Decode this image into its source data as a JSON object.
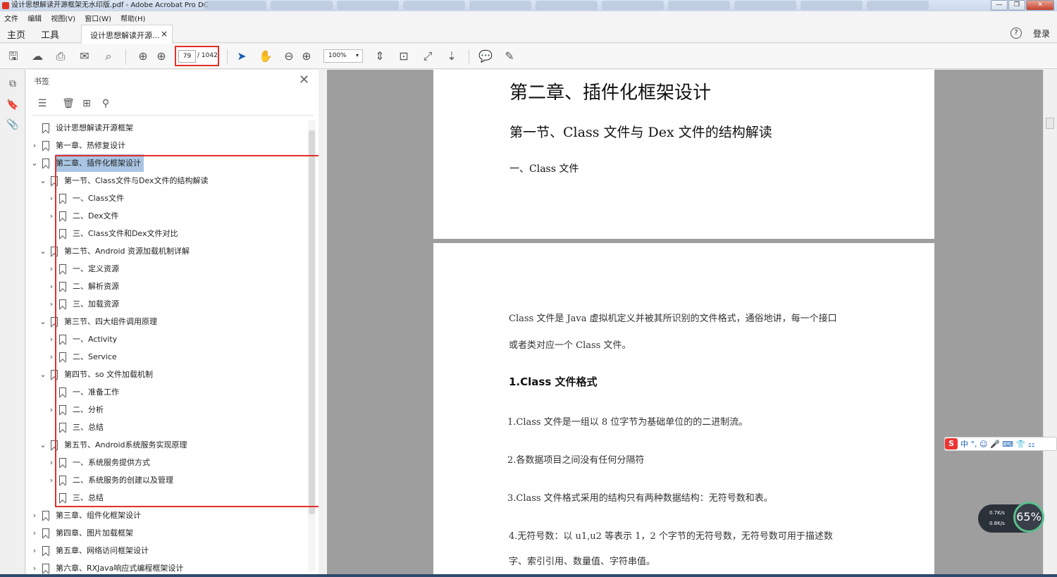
{
  "window": {
    "title": "设计思想解读开源框架无水印版.pdf - Adobe Acrobat Pro DC",
    "controls": [
      "—",
      "❐",
      "✕"
    ]
  },
  "menu": [
    "文件",
    "编辑",
    "视图(V)",
    "窗口(W)",
    "帮助(H)"
  ],
  "topnav": {
    "home": "主页",
    "tools": "工具",
    "doc_tab": "设计思想解读开源...",
    "close": "×",
    "help": "?",
    "login": "登录"
  },
  "toolbar": {
    "page_current": "79",
    "page_total": "/ 1042",
    "zoom": "100%"
  },
  "bookmarks": {
    "title": "书签",
    "items": [
      {
        "label": "设计思想解读开源框架",
        "level": 0,
        "chev": ""
      },
      {
        "label": "第一章、热修复设计",
        "level": 0,
        "chev": "›"
      },
      {
        "label": "第二章、插件化框架设计",
        "level": 0,
        "chev": "⌄"
      },
      {
        "label": "第一节、Class文件与Dex文件的结构解读",
        "level": 1,
        "chev": "⌄"
      },
      {
        "label": "一、Class文件",
        "level": 2,
        "chev": "›"
      },
      {
        "label": "二、Dex文件",
        "level": 2,
        "chev": "›"
      },
      {
        "label": "三、Class文件和Dex文件对比",
        "level": 2,
        "chev": ""
      },
      {
        "label": "第二节、Android 资源加载机制详解",
        "level": 1,
        "chev": "⌄"
      },
      {
        "label": "一、定义资源",
        "level": 2,
        "chev": "›"
      },
      {
        "label": "二、解析资源",
        "level": 2,
        "chev": "›"
      },
      {
        "label": "三、加载资源",
        "level": 2,
        "chev": "›"
      },
      {
        "label": "第三节、四大组件调用原理",
        "level": 1,
        "chev": "⌄"
      },
      {
        "label": "一、Activity",
        "level": 2,
        "chev": "›"
      },
      {
        "label": "二、Service",
        "level": 2,
        "chev": "›"
      },
      {
        "label": "第四节、so 文件加载机制",
        "level": 1,
        "chev": "⌄"
      },
      {
        "label": "一、准备工作",
        "level": 2,
        "chev": ""
      },
      {
        "label": "二、分析",
        "level": 2,
        "chev": "›"
      },
      {
        "label": "三、总结",
        "level": 2,
        "chev": ""
      },
      {
        "label": "第五节、Android系统服务实现原理",
        "level": 1,
        "chev": "⌄"
      },
      {
        "label": "一、系统服务提供方式",
        "level": 2,
        "chev": "›"
      },
      {
        "label": "二、系统服务的创建以及管理",
        "level": 2,
        "chev": "›"
      },
      {
        "label": "三、总结",
        "level": 2,
        "chev": ""
      },
      {
        "label": "第三章、组件化框架设计",
        "level": 0,
        "chev": "›"
      },
      {
        "label": "第四章、图片加载框架",
        "level": 0,
        "chev": "›"
      },
      {
        "label": "第五章、网络访问框架设计",
        "level": 0,
        "chev": "›"
      },
      {
        "label": "第六章、RXJava响应式编程框架设计",
        "level": 0,
        "chev": "›"
      }
    ]
  },
  "document": {
    "h1": "第二章、插件化框架设计",
    "h2": "第一节、Class 文件与 Dex 文件的结构解读",
    "h3": "一、Class 文件",
    "p1": "Class 文件是 Java 虚拟机定义并被其所识别的文件格式，通俗地讲，每一个接口",
    "p2": "或者类对应一个 Class 文件。",
    "bold": "1.Class 文件格式",
    "l1": "1.Class 文件是一组以 8 位字节为基础单位的的二进制流。",
    "l2": "2.各数据项目之间没有任何分隔符",
    "l3": "3.Class 文件格式采用的结构只有两种数据结构：无符号数和表。",
    "l4": "4.无符号数：以 u1,u2 等表示 1，2 个字节的无符号数，无符号数可用于描述数",
    "l5": "字、索引引用、数量值、字符串值。"
  },
  "ime": {
    "logo": "S",
    "text": "中 °, ☺ 🎤 ⌨ 👕 ⚏"
  },
  "net": {
    "up": "0.7K/s",
    "down": "0.8K/s",
    "percent": "65%"
  }
}
